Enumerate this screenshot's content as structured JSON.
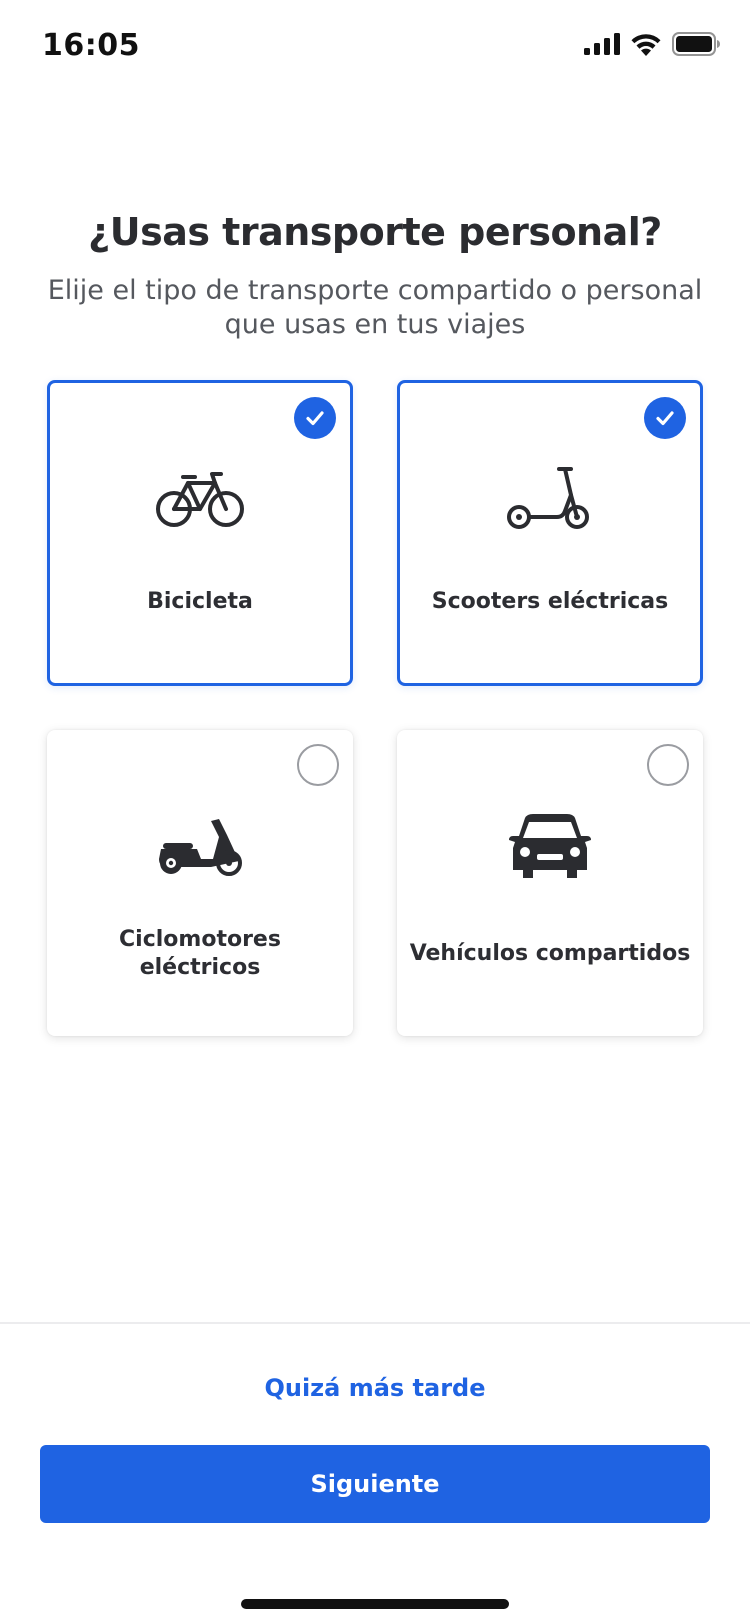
{
  "status_bar": {
    "time": "16:05",
    "icons": [
      "signal-icon",
      "wifi-icon",
      "battery-icon"
    ]
  },
  "header": {
    "title": "¿Usas transporte personal?",
    "subtitle_line1": "Elije el tipo de transporte compartido o personal",
    "subtitle_line2": "que usas en tus viajes"
  },
  "options": [
    {
      "icon": "bicycle-icon",
      "label_line1": "Bicicleta",
      "label_line2": "",
      "selected": true
    },
    {
      "icon": "kick-scooter-icon",
      "label_line1": "Scooters eléctricas",
      "label_line2": "",
      "selected": true
    },
    {
      "icon": "moped-icon",
      "label_line1": "Ciclomotores",
      "label_line2": "eléctricos",
      "selected": false
    },
    {
      "icon": "car-icon",
      "label_line1": "Vehículos compartidos",
      "label_line2": "",
      "selected": false
    }
  ],
  "footer": {
    "later_label": "Quizá más tarde",
    "next_label": "Siguiente"
  },
  "colors": {
    "accent": "#1f63e2",
    "text_primary": "#2b2c30",
    "text_secondary": "#55585e",
    "unchecked_border": "#9a9ca1"
  }
}
